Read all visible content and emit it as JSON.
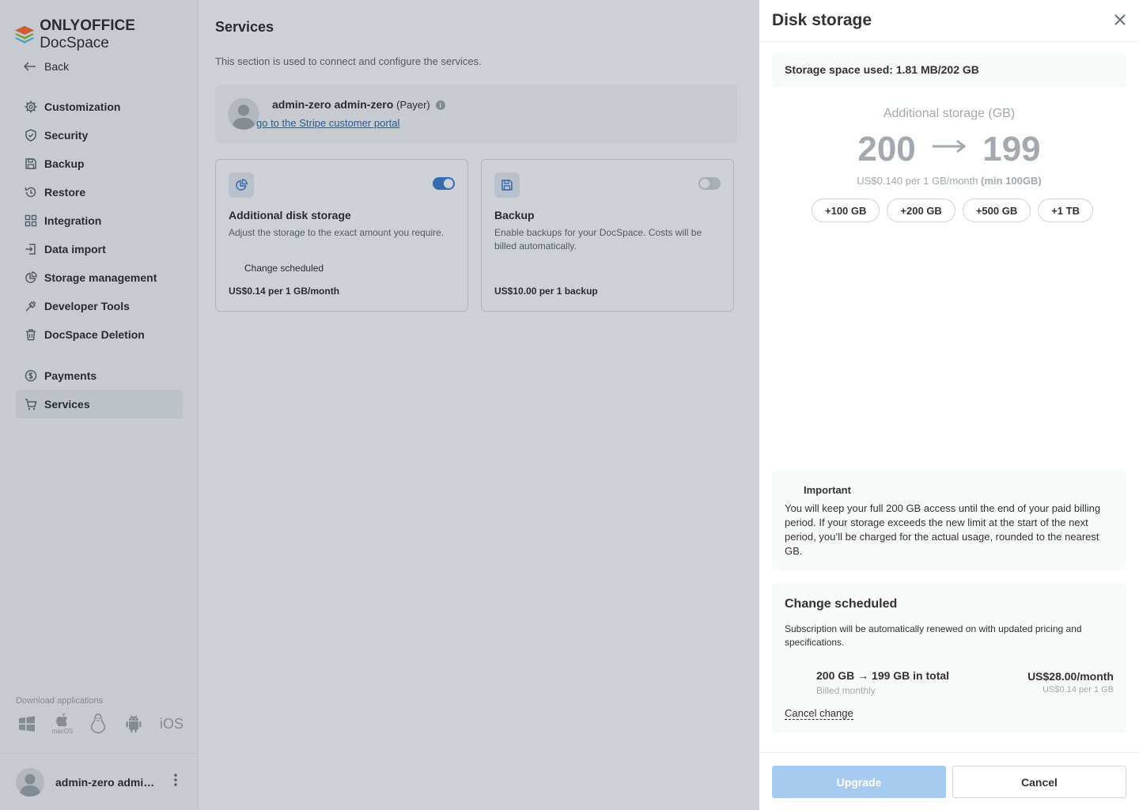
{
  "app": {
    "logo_bold": "ONLYOFFICE",
    "logo_rest": " DocSpace"
  },
  "sidebar": {
    "back_label": "Back",
    "items": [
      {
        "label": "Customization",
        "icon": "gear-icon"
      },
      {
        "label": "Security",
        "icon": "shield-icon"
      },
      {
        "label": "Backup",
        "icon": "floppy-icon"
      },
      {
        "label": "Restore",
        "icon": "history-icon"
      },
      {
        "label": "Integration",
        "icon": "grid-icon"
      },
      {
        "label": "Data import",
        "icon": "import-icon"
      },
      {
        "label": "Storage management",
        "icon": "pie-chart-icon"
      },
      {
        "label": "Developer Tools",
        "icon": "tool-icon"
      },
      {
        "label": "DocSpace Deletion",
        "icon": "trash-icon"
      }
    ],
    "items2": [
      {
        "label": "Payments",
        "icon": "dollar-icon"
      },
      {
        "label": "Services",
        "icon": "cart-icon",
        "active": true
      }
    ],
    "download_label": "Download applications",
    "platforms": [
      "windows-icon",
      "macos-icon",
      "linux-icon",
      "android-icon",
      "ios-icon"
    ],
    "macos_text": "macOS",
    "ios_text": "iOS",
    "profile_name": "admin-zero admin-..."
  },
  "main": {
    "title": "Services",
    "description": "This section is used to connect and configure the services.",
    "payer": {
      "name": "admin-zero admin-zero",
      "role": "(Payer)",
      "link": "go to the Stripe customer portal"
    },
    "cards": [
      {
        "title": "Additional disk storage",
        "description": "Adjust the storage to the exact amount you require.",
        "status": "Change scheduled",
        "price": "US$0.14 per 1 GB/month",
        "enabled": true,
        "icon": "pie-chart-icon"
      },
      {
        "title": "Backup",
        "description": "Enable backups for your DocSpace. Costs will be billed automatically.",
        "status": "",
        "price": "US$10.00 per 1 backup",
        "enabled": false,
        "icon": "floppy-icon"
      }
    ]
  },
  "panel": {
    "title": "Disk storage",
    "used": "Storage space used: 1.81 MB/202 GB",
    "additional_label": "Additional storage (GB)",
    "value_from": "200",
    "value_to": "199",
    "rate": "US$0.140 per 1 GB/month",
    "rate_min": "(min 100GB)",
    "chips": [
      "+100 GB",
      "+200 GB",
      "+500 GB",
      "+1 TB"
    ],
    "important_title": "Important",
    "important_text": "You will keep your full 200 GB access until the end of your paid billing period. If your storage exceeds the new limit at the start of the next period, you’ll be charged for the actual usage, rounded to the nearest GB.",
    "scheduled_title": "Change scheduled",
    "scheduled_text": "Subscription will be automatically renewed on with updated pricing and specifications.",
    "scheduled_line": "200 GB → 199 GB in total",
    "billed": "Billed monthly",
    "price": "US$28.00/month",
    "unit_price": "US$0.14 per 1 GB",
    "cancel_change": "Cancel change",
    "upgrade_label": "Upgrade",
    "cancel_label": "Cancel"
  },
  "colors": {
    "accent": "#4781d1",
    "link": "#316daa",
    "upgrade_disabled": "#a7cbf0",
    "overlay": "rgba(6,22,38,0.2)"
  }
}
